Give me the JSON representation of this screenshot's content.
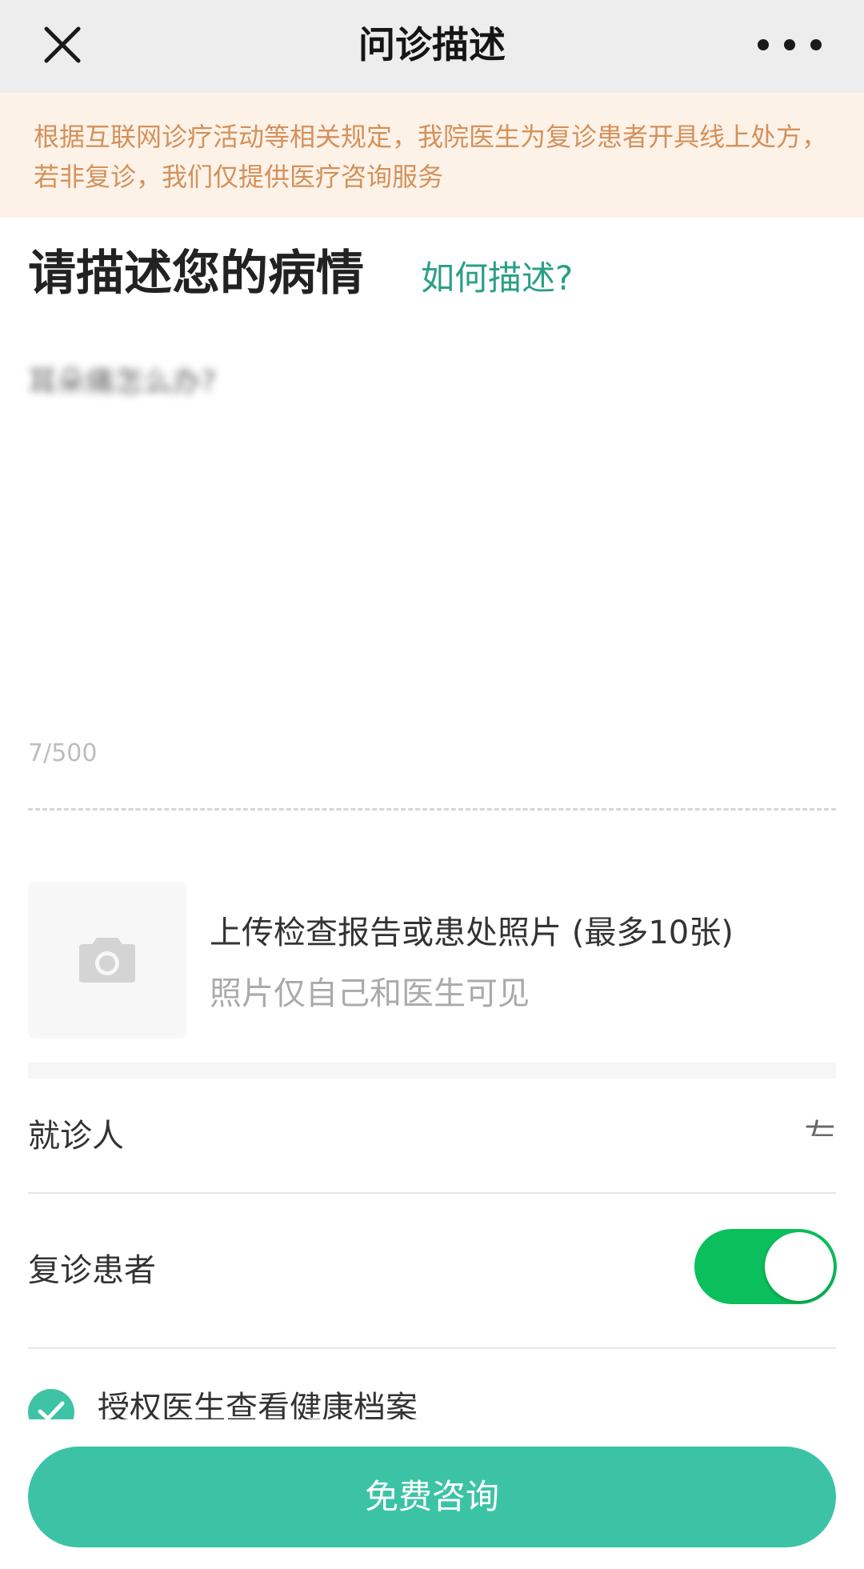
{
  "header": {
    "title": "问诊描述",
    "close_icon": "close-icon",
    "more_icon": "more-icon"
  },
  "notice": {
    "text": "根据互联网诊疗活动等相关规定，我院医生为复诊患者开具线上处方，若非复诊，我们仅提供医疗咨询服务"
  },
  "description": {
    "heading": "请描述您的病情",
    "help_link": "如何描述?",
    "value": "耳朵痛怎么办?",
    "counter": "7/500"
  },
  "upload": {
    "icon": "camera-icon",
    "title": "上传检查报告或患处照片 (最多10张)",
    "subtitle": "照片仅自己和医生可见"
  },
  "patient": {
    "label": "就诊人",
    "value": "左"
  },
  "revisit": {
    "label": "复诊患者",
    "enabled": true
  },
  "authorize": {
    "label": "授权医生查看健康档案",
    "checked": true
  },
  "cta": {
    "label": "免费咨询"
  },
  "colors": {
    "accent": "#3cc3a6",
    "toggle_on": "#0bbf5c",
    "notice_bg": "#fdf2e8",
    "notice_text": "#d4915a",
    "link": "#2a9f86"
  }
}
